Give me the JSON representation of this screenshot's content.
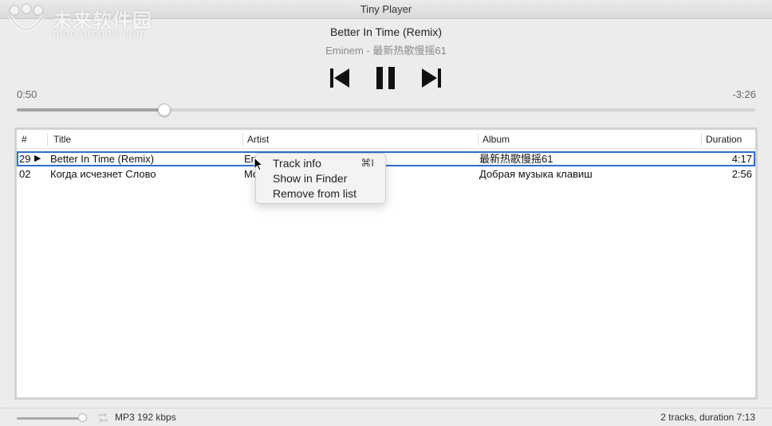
{
  "window": {
    "title": "Tiny Player"
  },
  "watermark": {
    "line1": "未来软件园",
    "line2": "mac.orsoon.com"
  },
  "now_playing": {
    "title": "Better In Time (Remix)",
    "subtitle": "Eminem - 最新热歌慢摇61",
    "elapsed": "0:50",
    "remaining": "-3:26",
    "progress_fraction": 0.2
  },
  "controls": {
    "previous": "previous-track",
    "pause": "pause",
    "next": "next-track"
  },
  "table": {
    "columns": [
      "#",
      "Title",
      "Artist",
      "Album",
      "Duration"
    ],
    "rows": [
      {
        "num": "29",
        "playing": true,
        "title": "Better In Time (Remix)",
        "artist": "Em",
        "album": "最新热歌慢摇61",
        "duration": "4:17",
        "selected": true
      },
      {
        "num": "02",
        "playing": false,
        "title": "Когда исчезнет Слово",
        "artist": "Mo",
        "album": "Добрая музыка клавиш",
        "duration": "2:56",
        "selected": false
      }
    ],
    "play_glyph": "▶"
  },
  "context_menu": {
    "items": [
      {
        "label": "Track info",
        "shortcut": "⌘I"
      },
      {
        "label": "Show in Finder",
        "shortcut": ""
      },
      {
        "label": "Remove from list",
        "shortcut": ""
      }
    ]
  },
  "statusbar": {
    "volume_fraction": 0.95,
    "format": "MP3 192 kbps",
    "summary": "2 tracks, duration 7:13"
  }
}
